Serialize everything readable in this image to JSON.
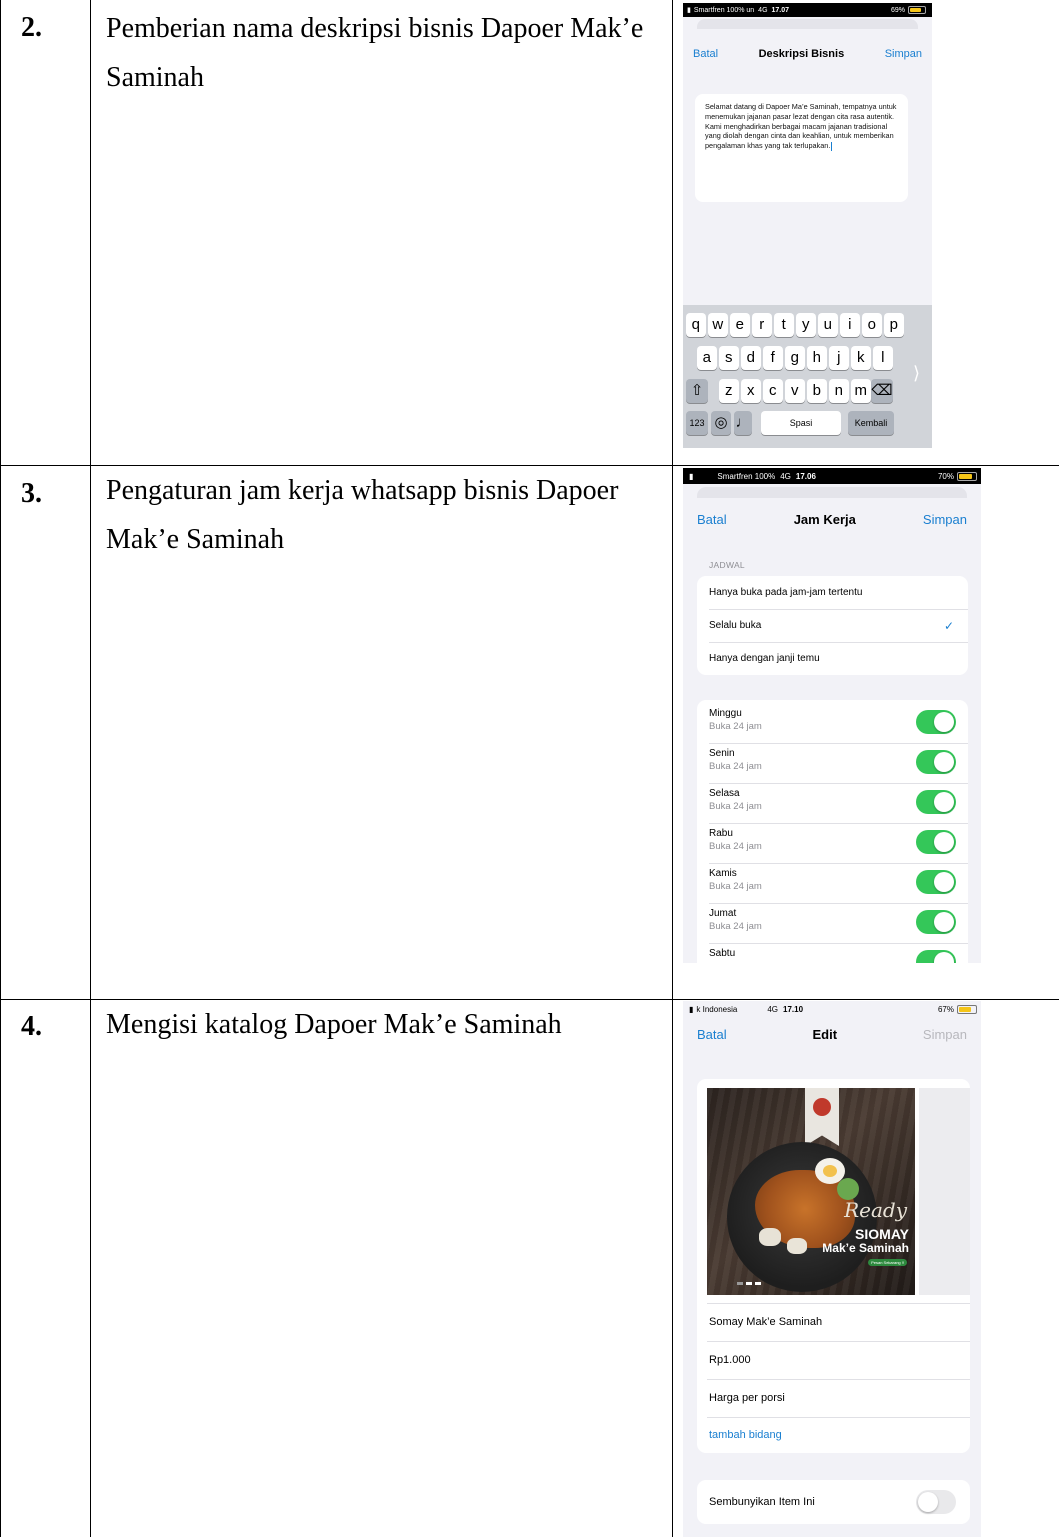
{
  "rows": [
    {
      "number": "2.",
      "description": "Pemberian nama deskripsi bisnis Dapoer Mak’e Saminah",
      "phone": {
        "status": {
          "carrier": "Smartfren 100% un",
          "network": "4G",
          "time": "17.07",
          "battery": "69%",
          "battery_level": 0.69
        },
        "nav": {
          "cancel": "Batal",
          "title": "Deskripsi Bisnis",
          "save": "Simpan"
        },
        "text": "Selamat datang di Dapoer Ma’e Saminah, tempatnya untuk menemukan jajanan pasar lezat dengan cita rasa autentik. Kami menghadirkan berbagai macam jajanan tradisional yang diolah dengan cinta dan keahlian, untuk memberikan pengalaman khas yang tak terlupakan.",
        "keyboard": {
          "row1": [
            "q",
            "w",
            "e",
            "r",
            "t",
            "y",
            "u",
            "i",
            "o",
            "p"
          ],
          "row2": [
            "a",
            "s",
            "d",
            "f",
            "g",
            "h",
            "j",
            "k",
            "l"
          ],
          "row3": [
            "z",
            "x",
            "c",
            "v",
            "b",
            "n",
            "m"
          ],
          "numbers": "123",
          "space": "Spasi",
          "return": "Kembali"
        }
      }
    },
    {
      "number": "3.",
      "description": "Pengaturan jam kerja whatsapp bisnis Dapoer Mak’e Saminah",
      "phone": {
        "status": {
          "carrier": "Smartfren 100%",
          "network": "4G",
          "time": "17.06",
          "battery": "70%",
          "battery_level": 0.7
        },
        "nav": {
          "cancel": "Batal",
          "title": "Jam Kerja",
          "save": "Simpan"
        },
        "section": "JADWAL",
        "options": [
          {
            "label": "Hanya buka pada jam-jam tertentu",
            "checked": false
          },
          {
            "label": "Selalu buka",
            "checked": true
          },
          {
            "label": "Hanya dengan janji temu",
            "checked": false
          }
        ],
        "check": "✓",
        "days": [
          {
            "day": "Minggu",
            "hours": "Buka 24 jam",
            "on": true
          },
          {
            "day": "Senin",
            "hours": "Buka 24 jam",
            "on": true
          },
          {
            "day": "Selasa",
            "hours": "Buka 24 jam",
            "on": true
          },
          {
            "day": "Rabu",
            "hours": "Buka 24 jam",
            "on": true
          },
          {
            "day": "Kamis",
            "hours": "Buka 24 jam",
            "on": true
          },
          {
            "day": "Jumat",
            "hours": "Buka 24 jam",
            "on": true
          },
          {
            "day": "Sabtu",
            "hours": "",
            "on": true
          }
        ]
      }
    },
    {
      "number": "4.",
      "description": "Mengisi katalog Dapoer Mak’e Saminah",
      "phone": {
        "status": {
          "carrier": "k Indonesia",
          "network": "4G",
          "time": "17.10",
          "battery": "67%",
          "battery_level": 0.67
        },
        "nav": {
          "cancel": "Batal",
          "title": "Edit",
          "save": "Simpan"
        },
        "product_image": {
          "script_word": "Ready",
          "headline": "SIOMAY",
          "brand": "Mak’e Saminah",
          "badge": "Pesan Sekarang !!"
        },
        "fields": [
          "Somay Mak’e Saminah",
          "Rp1.000",
          "Harga per porsi"
        ],
        "add_field": "tambah bidang",
        "hide_item": {
          "label": "Sembunyikan Item Ini",
          "on": false
        }
      }
    }
  ],
  "colors": {
    "accent": "#1a7fd0",
    "toggle_on": "#34c759",
    "sheet_bg": "#f2f2f7",
    "keyboard_bg": "#d1d4d9"
  }
}
